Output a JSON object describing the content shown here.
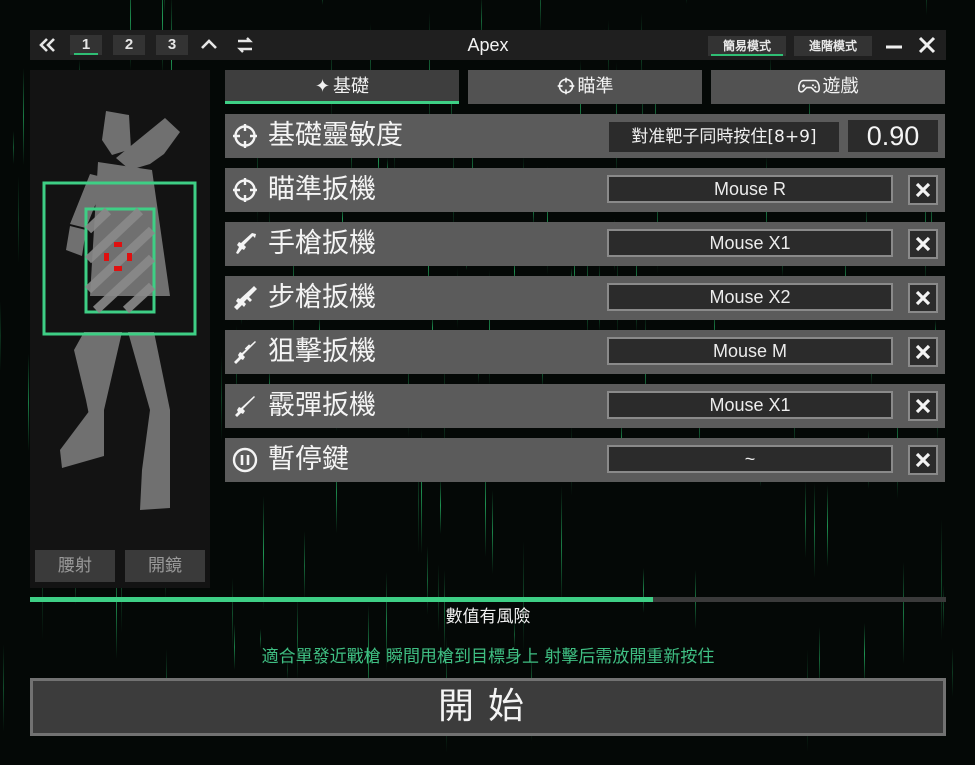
{
  "app": {
    "title": "Apex",
    "nav_icons": {
      "back": "double-chevron-left-icon",
      "collapse": "chevron-up-icon",
      "swap": "swap-icon"
    },
    "profiles": [
      "1",
      "2",
      "3"
    ],
    "active_profile": "1",
    "modes": [
      "簡易模式",
      "進階模式"
    ],
    "active_mode": "簡易模式",
    "window_controls": [
      "minimize-icon",
      "close-icon"
    ]
  },
  "tabs": [
    {
      "label": "基礎",
      "icon": "sparkle-icon",
      "active": true
    },
    {
      "label": "瞄準",
      "icon": "crosshair-icon",
      "active": false
    },
    {
      "label": "遊戲",
      "icon": "gamepad-icon",
      "active": false
    }
  ],
  "sensitivity": {
    "label": "基礎靈敏度",
    "icon": "crosshair-icon",
    "target_button": "對准靶子同時按住[8+9]",
    "value": "0.90"
  },
  "bindings": [
    {
      "label": "瞄準扳機",
      "icon": "crosshair-icon",
      "key": "Mouse R"
    },
    {
      "label": "手槍扳機",
      "icon": "pistol-icon",
      "key": "Mouse X1"
    },
    {
      "label": "步槍扳機",
      "icon": "rifle-icon",
      "key": "Mouse X2"
    },
    {
      "label": "狙擊扳機",
      "icon": "sniper-icon",
      "key": "Mouse M"
    },
    {
      "label": "霰彈扳機",
      "icon": "shotgun-icon",
      "key": "Mouse X1"
    },
    {
      "label": "暫停鍵",
      "icon": "pause-icon",
      "key": "~"
    }
  ],
  "left_panel": {
    "buttons": [
      "腰射",
      "開鏡"
    ],
    "figure_icon": "body-figure-icon"
  },
  "colors": {
    "accent": "#3ecf85",
    "hint": "#3fbf83",
    "target_dot": "#e01010"
  },
  "progress": {
    "fraction": 0.68
  },
  "risk_text": "數值有風險",
  "hint_text": "適合單發近戰槍 瞬間甩槍到目標身上 射擊后需放開重新按住",
  "start_label": "開始"
}
